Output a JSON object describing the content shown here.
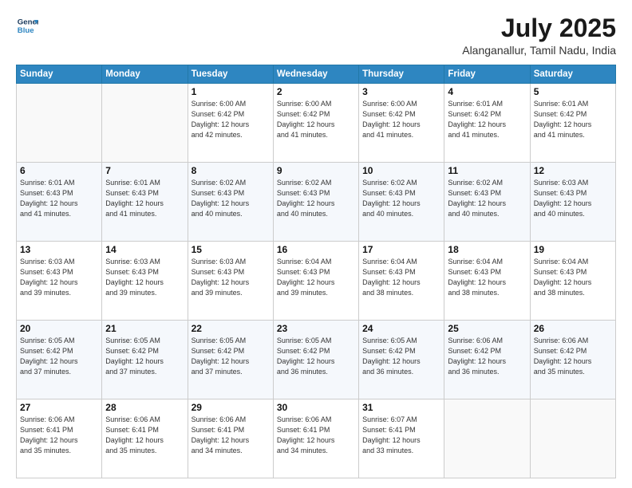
{
  "header": {
    "logo_line1": "General",
    "logo_line2": "Blue",
    "month_year": "July 2025",
    "location": "Alanganallur, Tamil Nadu, India"
  },
  "weekdays": [
    "Sunday",
    "Monday",
    "Tuesday",
    "Wednesday",
    "Thursday",
    "Friday",
    "Saturday"
  ],
  "weeks": [
    [
      {
        "day": "",
        "info": ""
      },
      {
        "day": "",
        "info": ""
      },
      {
        "day": "1",
        "info": "Sunrise: 6:00 AM\nSunset: 6:42 PM\nDaylight: 12 hours\nand 42 minutes."
      },
      {
        "day": "2",
        "info": "Sunrise: 6:00 AM\nSunset: 6:42 PM\nDaylight: 12 hours\nand 41 minutes."
      },
      {
        "day": "3",
        "info": "Sunrise: 6:00 AM\nSunset: 6:42 PM\nDaylight: 12 hours\nand 41 minutes."
      },
      {
        "day": "4",
        "info": "Sunrise: 6:01 AM\nSunset: 6:42 PM\nDaylight: 12 hours\nand 41 minutes."
      },
      {
        "day": "5",
        "info": "Sunrise: 6:01 AM\nSunset: 6:42 PM\nDaylight: 12 hours\nand 41 minutes."
      }
    ],
    [
      {
        "day": "6",
        "info": "Sunrise: 6:01 AM\nSunset: 6:43 PM\nDaylight: 12 hours\nand 41 minutes."
      },
      {
        "day": "7",
        "info": "Sunrise: 6:01 AM\nSunset: 6:43 PM\nDaylight: 12 hours\nand 41 minutes."
      },
      {
        "day": "8",
        "info": "Sunrise: 6:02 AM\nSunset: 6:43 PM\nDaylight: 12 hours\nand 40 minutes."
      },
      {
        "day": "9",
        "info": "Sunrise: 6:02 AM\nSunset: 6:43 PM\nDaylight: 12 hours\nand 40 minutes."
      },
      {
        "day": "10",
        "info": "Sunrise: 6:02 AM\nSunset: 6:43 PM\nDaylight: 12 hours\nand 40 minutes."
      },
      {
        "day": "11",
        "info": "Sunrise: 6:02 AM\nSunset: 6:43 PM\nDaylight: 12 hours\nand 40 minutes."
      },
      {
        "day": "12",
        "info": "Sunrise: 6:03 AM\nSunset: 6:43 PM\nDaylight: 12 hours\nand 40 minutes."
      }
    ],
    [
      {
        "day": "13",
        "info": "Sunrise: 6:03 AM\nSunset: 6:43 PM\nDaylight: 12 hours\nand 39 minutes."
      },
      {
        "day": "14",
        "info": "Sunrise: 6:03 AM\nSunset: 6:43 PM\nDaylight: 12 hours\nand 39 minutes."
      },
      {
        "day": "15",
        "info": "Sunrise: 6:03 AM\nSunset: 6:43 PM\nDaylight: 12 hours\nand 39 minutes."
      },
      {
        "day": "16",
        "info": "Sunrise: 6:04 AM\nSunset: 6:43 PM\nDaylight: 12 hours\nand 39 minutes."
      },
      {
        "day": "17",
        "info": "Sunrise: 6:04 AM\nSunset: 6:43 PM\nDaylight: 12 hours\nand 38 minutes."
      },
      {
        "day": "18",
        "info": "Sunrise: 6:04 AM\nSunset: 6:43 PM\nDaylight: 12 hours\nand 38 minutes."
      },
      {
        "day": "19",
        "info": "Sunrise: 6:04 AM\nSunset: 6:43 PM\nDaylight: 12 hours\nand 38 minutes."
      }
    ],
    [
      {
        "day": "20",
        "info": "Sunrise: 6:05 AM\nSunset: 6:42 PM\nDaylight: 12 hours\nand 37 minutes."
      },
      {
        "day": "21",
        "info": "Sunrise: 6:05 AM\nSunset: 6:42 PM\nDaylight: 12 hours\nand 37 minutes."
      },
      {
        "day": "22",
        "info": "Sunrise: 6:05 AM\nSunset: 6:42 PM\nDaylight: 12 hours\nand 37 minutes."
      },
      {
        "day": "23",
        "info": "Sunrise: 6:05 AM\nSunset: 6:42 PM\nDaylight: 12 hours\nand 36 minutes."
      },
      {
        "day": "24",
        "info": "Sunrise: 6:05 AM\nSunset: 6:42 PM\nDaylight: 12 hours\nand 36 minutes."
      },
      {
        "day": "25",
        "info": "Sunrise: 6:06 AM\nSunset: 6:42 PM\nDaylight: 12 hours\nand 36 minutes."
      },
      {
        "day": "26",
        "info": "Sunrise: 6:06 AM\nSunset: 6:42 PM\nDaylight: 12 hours\nand 35 minutes."
      }
    ],
    [
      {
        "day": "27",
        "info": "Sunrise: 6:06 AM\nSunset: 6:41 PM\nDaylight: 12 hours\nand 35 minutes."
      },
      {
        "day": "28",
        "info": "Sunrise: 6:06 AM\nSunset: 6:41 PM\nDaylight: 12 hours\nand 35 minutes."
      },
      {
        "day": "29",
        "info": "Sunrise: 6:06 AM\nSunset: 6:41 PM\nDaylight: 12 hours\nand 34 minutes."
      },
      {
        "day": "30",
        "info": "Sunrise: 6:06 AM\nSunset: 6:41 PM\nDaylight: 12 hours\nand 34 minutes."
      },
      {
        "day": "31",
        "info": "Sunrise: 6:07 AM\nSunset: 6:41 PM\nDaylight: 12 hours\nand 33 minutes."
      },
      {
        "day": "",
        "info": ""
      },
      {
        "day": "",
        "info": ""
      }
    ]
  ]
}
